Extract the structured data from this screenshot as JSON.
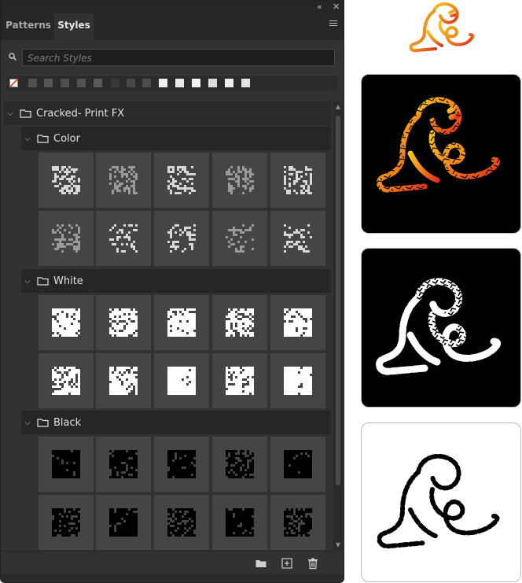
{
  "panel": {
    "tabs": [
      {
        "label": "Patterns",
        "active": false
      },
      {
        "label": "Styles",
        "active": true
      }
    ],
    "search": {
      "placeholder": "Search Styles",
      "value": ""
    },
    "groups": [
      {
        "label": "Cracked- Print FX",
        "expanded": true,
        "type": "root"
      },
      {
        "label": "Color",
        "expanded": true,
        "type": "sub"
      },
      {
        "label": "White",
        "expanded": true,
        "type": "sub"
      },
      {
        "label": "Black",
        "expanded": true,
        "type": "sub"
      }
    ],
    "icons": {
      "collapse": "double-chevron-icon",
      "close": "close-icon",
      "menu": "panel-menu-icon",
      "search": "search-icon",
      "new_group": "folder-icon",
      "new_style": "new-style-icon",
      "delete": "trash-icon"
    }
  },
  "colors": {
    "panel_bg": "#323232",
    "tile_bg": "#454545",
    "accent_orange": "#f28a1a",
    "accent_red": "#e0301e",
    "accent_yellow": "#f7c21d"
  }
}
